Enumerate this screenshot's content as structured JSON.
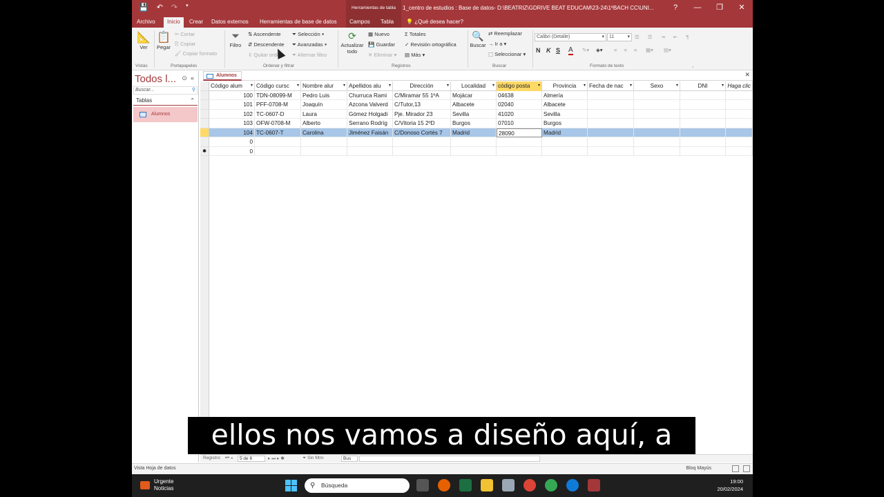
{
  "titlebar": {
    "context_group": "Herramientas de tabla",
    "title": "1_centro de estudios : Base de datos- D:\\BEATRIZ\\GDRIVE BEAT EDUCAM\\23-24\\1ºBACH CC\\UNI...",
    "help": "?",
    "minimize": "—",
    "restore": "❐",
    "close": "✕"
  },
  "tabs": [
    "Archivo",
    "Inicio",
    "Crear",
    "Datos externos",
    "Herramientas de base de datos",
    "Campos",
    "Tabla"
  ],
  "tell_me": "¿Qué desea hacer?",
  "ribbon": {
    "views": {
      "label": "Vistas",
      "btn": "Ver"
    },
    "clipboard": {
      "label": "Portapapeles",
      "paste": "Pegar",
      "cut": "Cortar",
      "copy": "Copiar",
      "format": "Copiar formato"
    },
    "sort": {
      "label": "Ordenar y filtrar",
      "filter": "Filtro",
      "asc": "Ascendente",
      "desc": "Descendente",
      "remove": "Quitar orden",
      "selection": "Selección",
      "advanced": "Avanzadas",
      "toggle": "Alternar filtro"
    },
    "records": {
      "label": "Registros",
      "refresh": "Actualizar todo",
      "new": "Nuevo",
      "save": "Guardar",
      "delete": "Eliminar",
      "totals": "Totales",
      "spelling": "Revisión ortográfica",
      "more": "Más"
    },
    "find": {
      "label": "Buscar",
      "find": "Buscar",
      "replace": "Reemplazar",
      "goto": "Ir a",
      "select": "Seleccionar"
    },
    "text": {
      "label": "Formato de texto",
      "font": "Calibri (Detalle)",
      "size": "11",
      "bold": "N",
      "italic": "K",
      "underline": "S",
      "color": "A"
    }
  },
  "nav": {
    "title": "Todos l...",
    "search_placeholder": "Buscar...",
    "group": "Tablas",
    "item": "Alumnos"
  },
  "doc_tab": "Alumnos",
  "table": {
    "columns": [
      "Código alum",
      "Código cursc",
      "Nombre alur",
      "Apellidos alu",
      "Dirección",
      "Localidad",
      "código posta",
      "Provincia",
      "Fecha de nac",
      "Sexo",
      "DNI",
      "Haga clic"
    ],
    "rows": [
      [
        "100",
        "TDN-08099-M",
        "Pedro Luis",
        "Churruca Rami",
        "C/Miramar 55 1ºA",
        "Mojácar",
        "04638",
        "Almería"
      ],
      [
        "101",
        "PFF-0708-M",
        "Joaquín",
        "Azcona Valverd",
        "C/Tutor,13",
        "Albacete",
        "02040",
        "Albacete"
      ],
      [
        "102",
        "TC-0607-D",
        "Laura",
        "Gómez Holgadi",
        "Pje. Mirador 23",
        "Sevilla",
        "41020",
        "Sevilla"
      ],
      [
        "103",
        "OFW-0708-M",
        "Alberto",
        "Serrano Rodríg",
        "C/Vitoria 15 2ºD",
        "Burgos",
        "07010",
        "Burgos"
      ],
      [
        "104",
        "TC-0607-T",
        "Carolina",
        "Jiménez Faisán",
        "C/Donoso Cortés 7",
        "Madrid",
        "28090",
        "Madrid"
      ],
      [
        "0",
        "",
        "",
        "",
        "",
        "",
        "",
        ""
      ],
      [
        "0",
        "",
        "",
        "",
        "",
        "",
        "",
        ""
      ]
    ],
    "new_row_marker": "✱"
  },
  "record_nav": {
    "label": "Registro:",
    "position": "5 de 6",
    "filter": "Sin filtro",
    "search": "Bus"
  },
  "status": {
    "left": "Vista Hoja de datos",
    "right": "Bloq Mayús"
  },
  "taskbar": {
    "news_title": "Urgente",
    "news_sub": "Noticias",
    "search": "Búsqueda",
    "time": "19:00",
    "date": "20/02/2024"
  },
  "subtitle": "ellos nos vamos a diseño aquí, a",
  "colors": {
    "accent": "#a4373a",
    "selected_row": "#a7c6e8",
    "selected_header": "#ffd966"
  }
}
